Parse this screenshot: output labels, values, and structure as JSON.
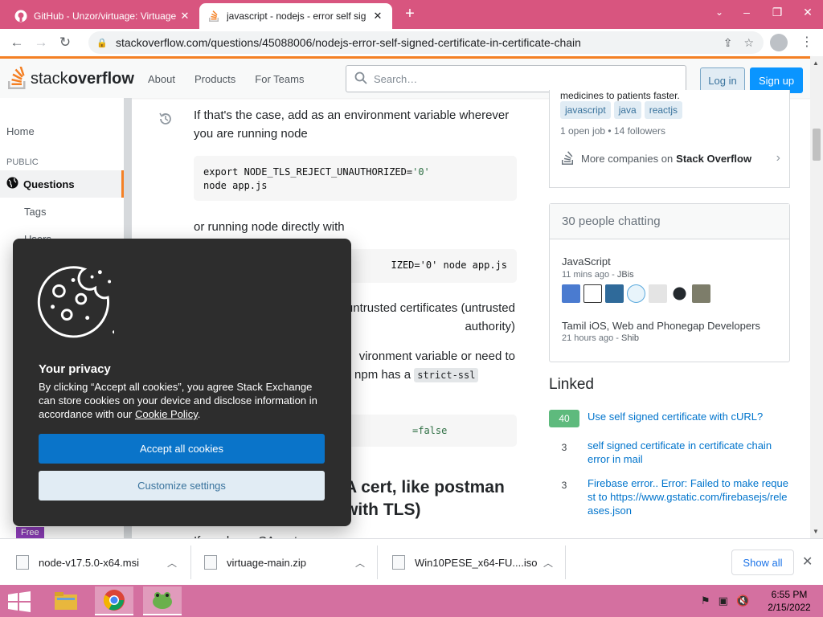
{
  "browser": {
    "tabs": [
      {
        "title": "GitHub - Unzor/virtuage: Virtuage",
        "active": false
      },
      {
        "title": "javascript - nodejs - error self sig",
        "active": true
      }
    ],
    "url": "stackoverflow.com/questions/45088006/nodejs-error-self-signed-certificate-in-certificate-chain"
  },
  "header": {
    "logo_light": "stack",
    "logo_bold": "overflow",
    "nav": [
      "About",
      "Products",
      "For Teams"
    ],
    "search_placeholder": "Search…",
    "login": "Log in",
    "signup": "Sign up"
  },
  "sidebar": {
    "home": "Home",
    "public": "PUBLIC",
    "questions": "Questions",
    "tags": "Tags",
    "users": "Users",
    "free": "Free"
  },
  "answer": {
    "p1": "If that's the case, add as an environment variable wherever you are running node",
    "code1_prefix": "export NODE_TLS_REJECT_UNAUTHORIZED=",
    "code1_str": "'0'",
    "code1_line2": "node app.js",
    "p2": "or running node directly with",
    "code2": "IZED='0' node app.js",
    "p3a": "untrusted certificates (untrusted",
    "p3b": "authority)",
    "p4a": "vironment variable or need to",
    "p4b": "ns npm has a",
    "p4_code": "strict-ssl",
    "code3": "=false",
    "h2_line1": "A cert, like postman",
    "h2_line2": "with TLS)",
    "p5": "If you know CA cert"
  },
  "jobs": {
    "text": "medicines to patients faster.",
    "tags": [
      "javascript",
      "java",
      "reactjs"
    ],
    "meta": "1 open job • 14 followers",
    "more_prefix": "More companies on",
    "more_bold": "Stack Overflow"
  },
  "chat": {
    "header": "30 people chatting",
    "rooms": [
      {
        "name": "JavaScript",
        "time": "11 mins ago",
        "user": "JBis"
      },
      {
        "name": "Tamil iOS, Web and Phonegap Developers",
        "time": "21 hours ago",
        "user": "Shib"
      }
    ]
  },
  "linked": {
    "title": "Linked",
    "items": [
      {
        "score": "40",
        "accepted": true,
        "title": "Use self signed certificate with cURL?"
      },
      {
        "score": "3",
        "accepted": false,
        "title": "self signed certificate in certificate chain error in mail"
      },
      {
        "score": "3",
        "accepted": false,
        "title": "Firebase error.. Error: Failed to make request to https://www.gstatic.com/firebasejs/releases.json"
      }
    ]
  },
  "cookie": {
    "title": "Your privacy",
    "text_before": "By clicking “Accept all cookies”, you agree Stack Exchange can store cookies on your device and disclose information in accordance with our ",
    "link": "Cookie Policy",
    "text_after": ".",
    "accept": "Accept all cookies",
    "customize": "Customize settings"
  },
  "downloads": {
    "items": [
      "node-v17.5.0-x64.msi",
      "virtuage-main.zip",
      "Win10PESE_x64-FU....iso"
    ],
    "show_all": "Show all"
  },
  "taskbar": {
    "time": "6:55 PM",
    "date": "2/15/2022"
  },
  "colors": {
    "accent": "#f48024",
    "link": "#0074cc",
    "primary_button": "#0a95ff",
    "accepted": "#5eba7d",
    "chrome_frame": "#d8557f"
  }
}
